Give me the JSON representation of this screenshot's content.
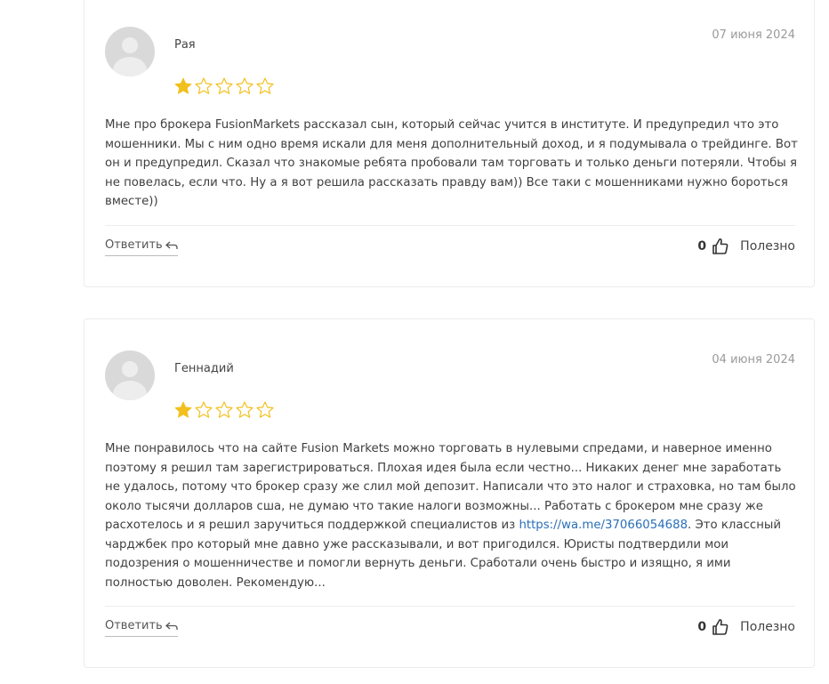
{
  "reviews": [
    {
      "author": "Рая",
      "date": "07 июня 2024",
      "rating": 1,
      "max_rating": 5,
      "text": "Мне про брокера FusionMarkets рассказал сын, который сейчас учится в институте. И предупредил что это мошенники. Мы с ним одно время искали для меня дополнительный доход, и я подумывала о трейдинге. Вот он и предупредил. Сказал что знакомые ребята пробовали там торговать и только деньги потеряли. Чтобы я не повелась, если что. Ну а я вот решила рассказать правду вам)) Все таки с мошенниками нужно бороться вместе))",
      "reply_label": "Ответить",
      "useful_count": "0",
      "useful_label": "Полезно"
    },
    {
      "author": "Геннадий",
      "date": "04 июня 2024",
      "rating": 1,
      "max_rating": 5,
      "text_before_link": "Мне понравилось что на сайте Fusion Markets можно торговать в нулевыми спредами, и наверное именно поэтому я решил там зарегистрироваться. Плохая идея была если честно... Никаких денег мне заработать не удалось, потому что брокер сразу же слил мой депозит. Написали что это налог и страховка, но там было около тысячи долларов сша, не думаю что такие налоги возможны... Работать с брокером мне сразу же расхотелось и я решил заручиться поддержкой специалистов из ",
      "link": "https://wa.me/37066054688",
      "text_after_link": ". Это классный чарджбек про который мне давно уже рассказывали, и вот пригодился. Юристы подтвердили мои подозрения о мошенничестве и помогли вернуть деньги. Сработали очень быстро и изящно, я ими полностью доволен. Рекомендую...",
      "reply_label": "Ответить",
      "useful_count": "0",
      "useful_label": "Полезно"
    }
  ],
  "colors": {
    "star_filled": "#f2c01e",
    "star_empty": "#f2c01e",
    "link": "#2a6fb8",
    "date": "#9a9a9a"
  }
}
